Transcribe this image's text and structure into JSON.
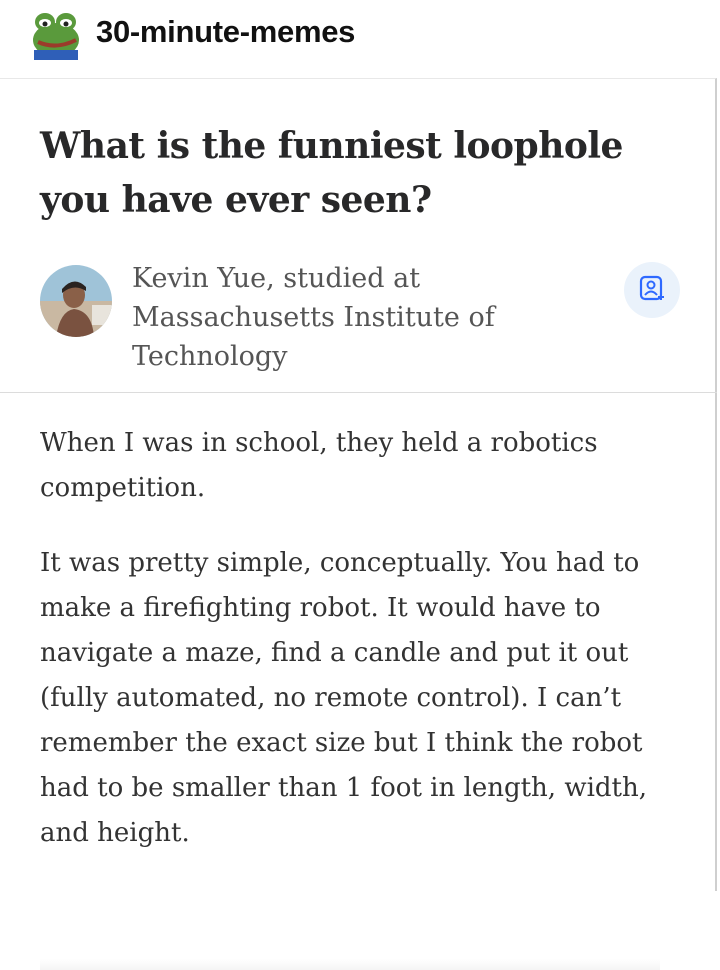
{
  "header": {
    "blog_name": "30-minute-memes",
    "avatar_icon": "pepe-frog-icon"
  },
  "post": {
    "question": "What is the funniest loophole you have ever seen?",
    "author": {
      "credential": "Kevin Yue, studied at Massachusetts Institute of Technology",
      "follow_icon": "add-person-icon"
    },
    "answer_paragraphs": [
      "When I was in school, they held a robotics competition.",
      "It was pretty simple, conceptually. You had to make a firefighting robot. It would have to navigate a maze, find a candle and put it out (fully automated, no remote control). I can’t remember the exact size but I think the robot had to be smaller than 1 foot in length, width, and height."
    ]
  },
  "colors": {
    "accent": "#2e69ff",
    "follow_bg": "#eaf2fb",
    "text": "#333333"
  }
}
